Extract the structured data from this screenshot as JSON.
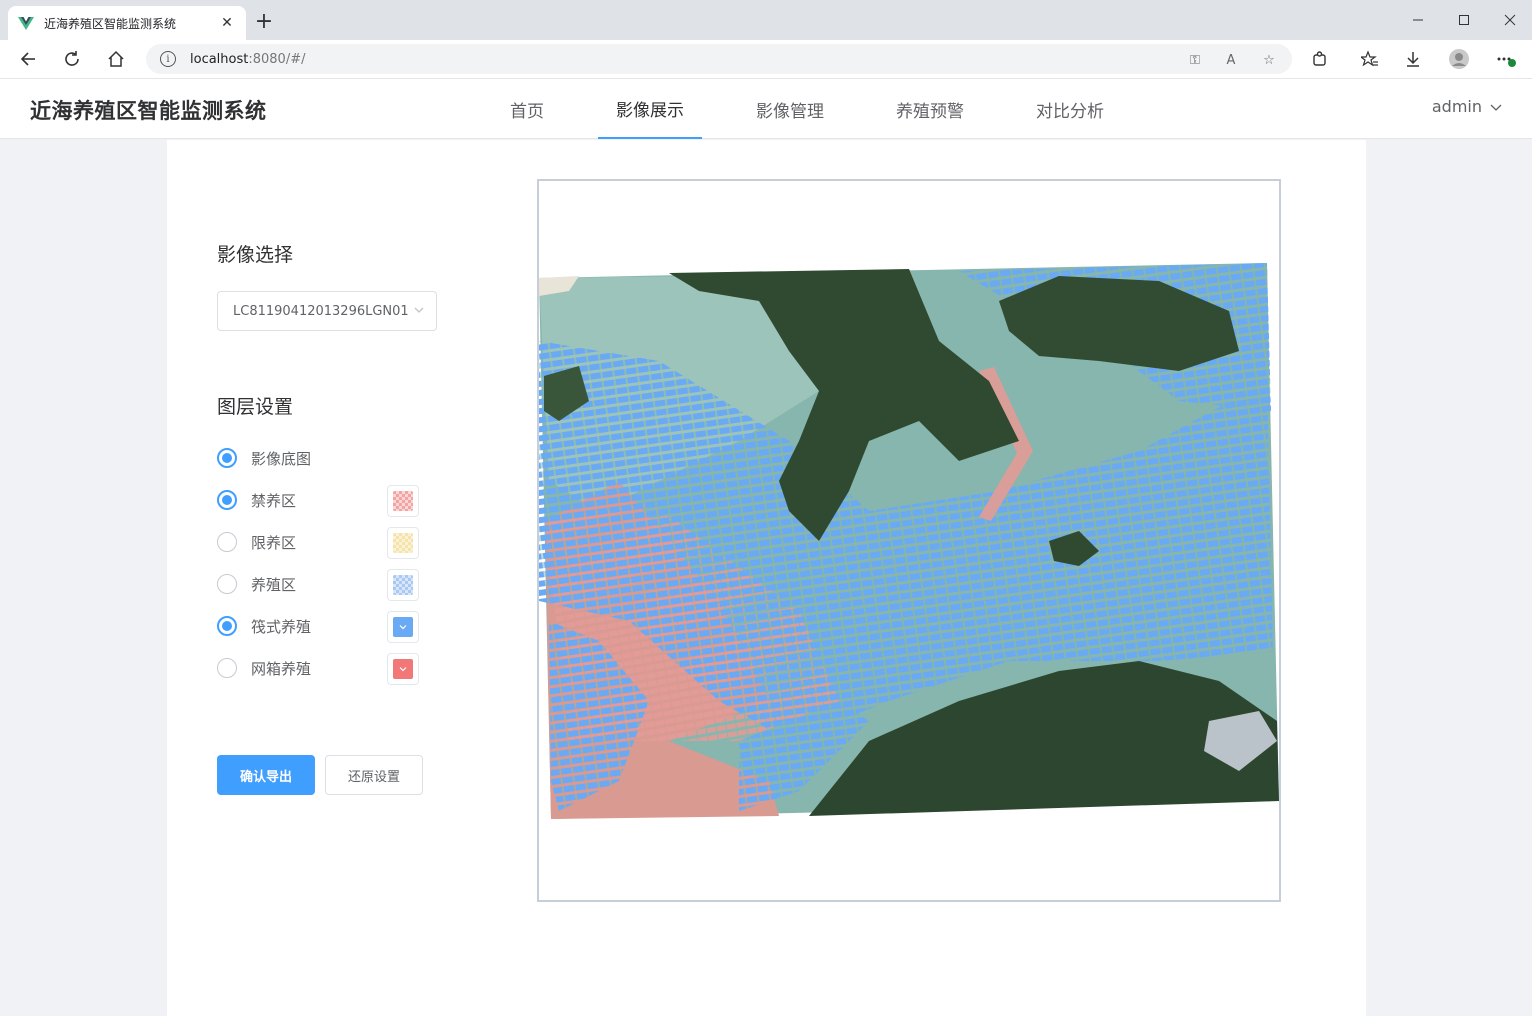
{
  "browser": {
    "tab_title": "近海养殖区智能监测系统",
    "url_host": "localhost",
    "url_rest": ":8080/#/"
  },
  "app": {
    "title": "近海养殖区智能监测系统",
    "nav": [
      {
        "label": "首页",
        "active": false
      },
      {
        "label": "影像展示",
        "active": true
      },
      {
        "label": "影像管理",
        "active": false
      },
      {
        "label": "养殖预警",
        "active": false
      },
      {
        "label": "对比分析",
        "active": false
      }
    ],
    "user": "admin"
  },
  "panel": {
    "image_select_title": "影像选择",
    "image_select_value": "LC81190412013296LGN01",
    "layer_title": "图层设置",
    "layers": [
      {
        "label": "影像底图",
        "checked": true,
        "swatch": null
      },
      {
        "label": "禁养区",
        "checked": true,
        "swatch": "#f4a3a3",
        "pattern": "checker"
      },
      {
        "label": "限养区",
        "checked": false,
        "swatch": "#f5e3a8",
        "pattern": "checker"
      },
      {
        "label": "养殖区",
        "checked": false,
        "swatch": "#a9c8f2",
        "pattern": "checker"
      },
      {
        "label": "筏式养殖",
        "checked": true,
        "swatch": "#6aaaf5",
        "pattern": "solid"
      },
      {
        "label": "网箱养殖",
        "checked": false,
        "swatch": "#f27777",
        "pattern": "solid"
      }
    ],
    "confirm_button": "确认导出",
    "reset_button": "还原设置"
  },
  "colors": {
    "accent": "#409eff",
    "raft_overlay": "#6aaaf5",
    "forbidden_overlay": "#e89a96",
    "sea": "#7fb0a8",
    "land": "#2e4a32"
  }
}
